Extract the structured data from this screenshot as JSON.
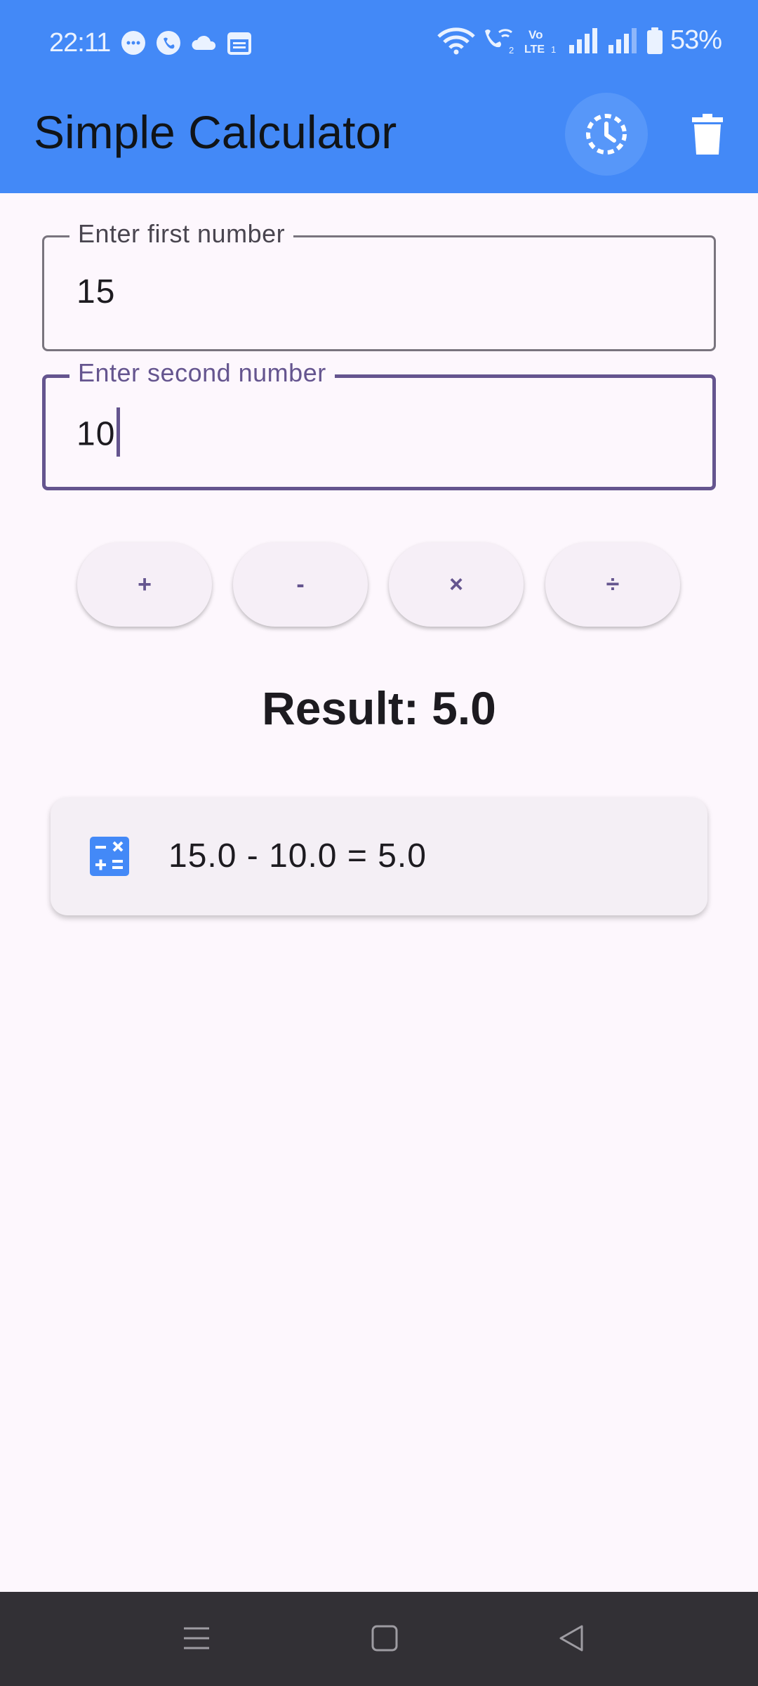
{
  "status_bar": {
    "time": "22:11",
    "battery": "53%",
    "left_icons": [
      "messages-icon",
      "chat-icon",
      "cloud-icon",
      "calendar-icon"
    ],
    "right_icons": [
      "wifi-icon",
      "wifi-call-icon",
      "volte-icon",
      "signal-icon",
      "signal-icon",
      "battery-icon"
    ]
  },
  "app_bar": {
    "title": "Simple Calculator",
    "actions": [
      "history-icon",
      "delete-icon"
    ]
  },
  "inputs": {
    "first": {
      "label": "Enter first number",
      "value": "15"
    },
    "second": {
      "label": "Enter second number",
      "value": "10"
    }
  },
  "operators": {
    "add": "+",
    "subtract": "-",
    "multiply": "×",
    "divide": "÷"
  },
  "result": "Result: 5.0",
  "history": [
    {
      "icon": "calculate-icon",
      "text": "15.0 - 10.0 = 5.0"
    }
  ],
  "colors": {
    "app_bar": "#4389f7",
    "primary": "#65558f",
    "background": "#fdf7fd",
    "nav_bar": "#323035"
  }
}
